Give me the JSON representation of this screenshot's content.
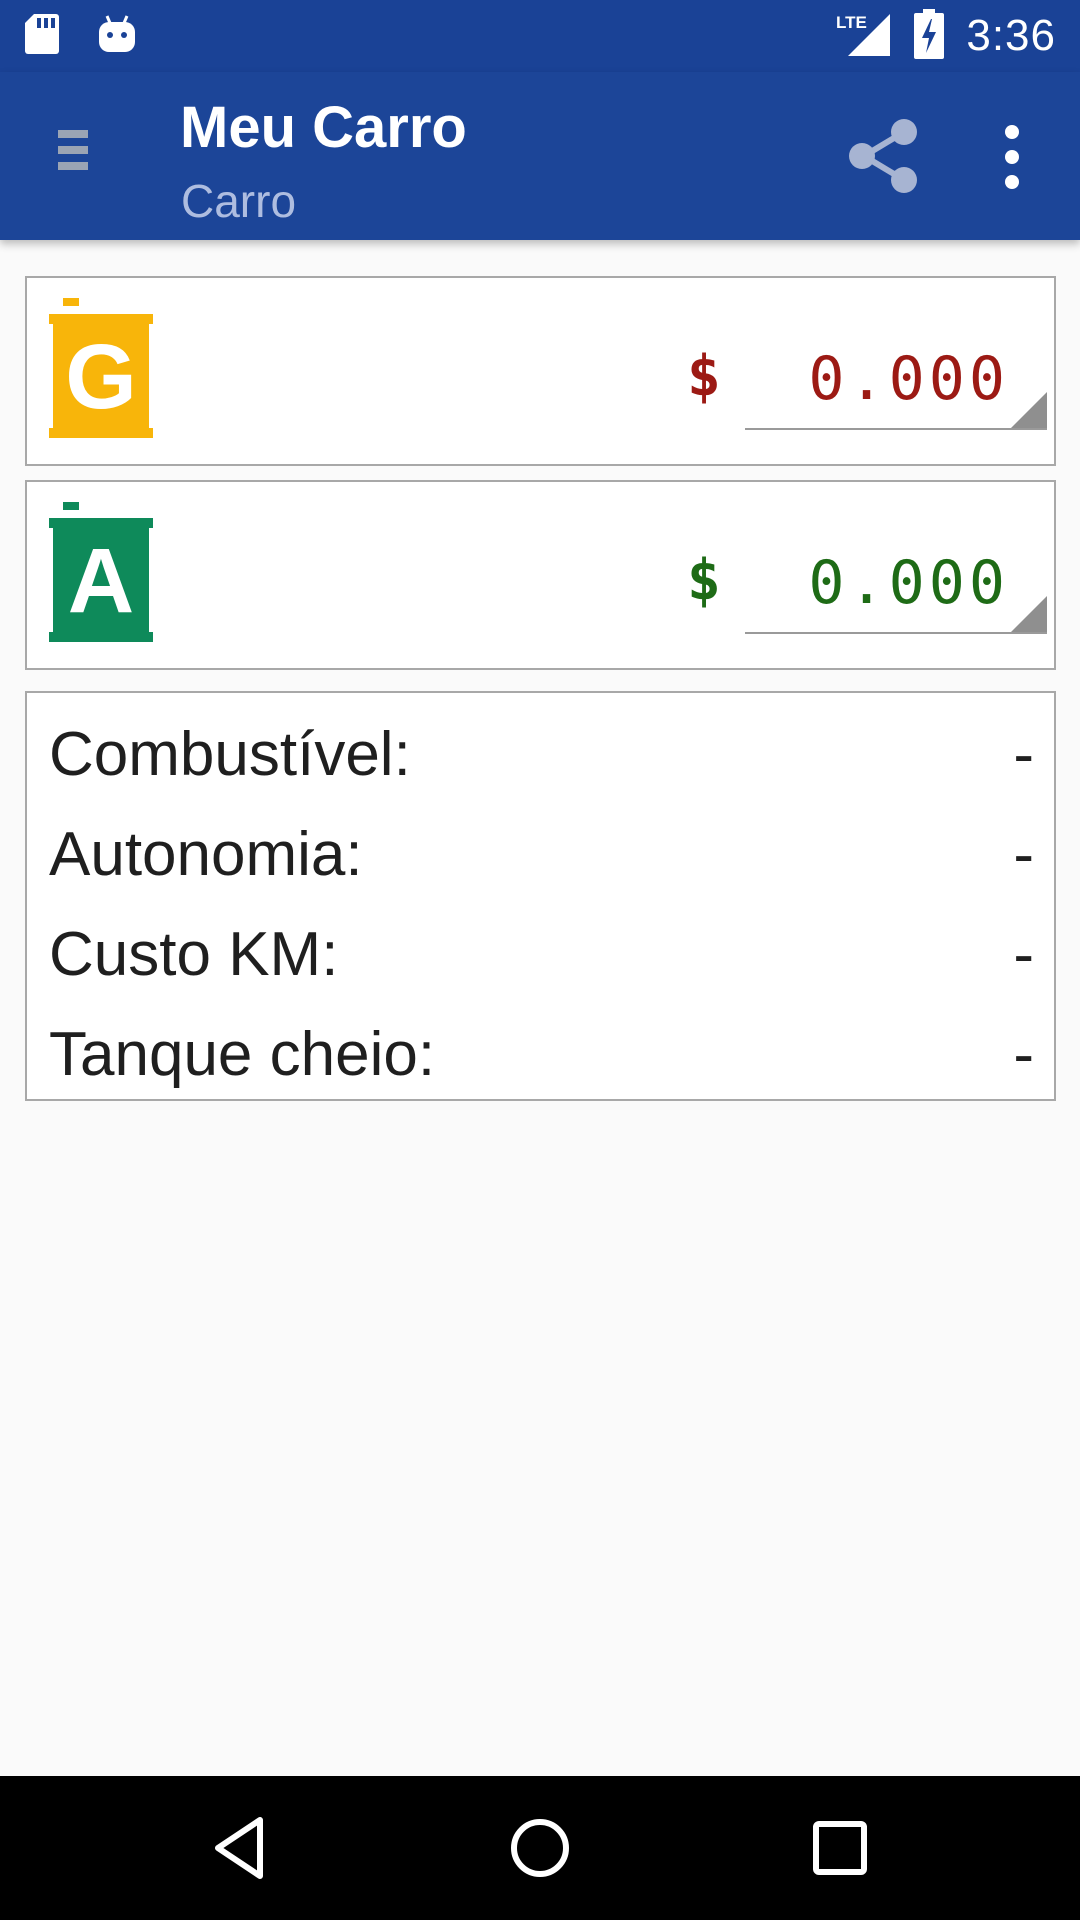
{
  "status_bar": {
    "time": "3:36",
    "network": "LTE",
    "left_icons": [
      "sd-card-icon",
      "android-icon"
    ]
  },
  "app_bar": {
    "title": "Meu Carro",
    "subtitle": "Carro",
    "actions": [
      "menu-icon",
      "share-icon",
      "more-vert-icon"
    ]
  },
  "fuels": [
    {
      "letter": "G",
      "currency": "$",
      "price": "0.000",
      "icon_color": "#f8b50a",
      "text_color": "#9c1a14"
    },
    {
      "letter": "A",
      "currency": "$",
      "price": "0.000",
      "icon_color": "#0e8a5a",
      "text_color": "#1e6b16"
    }
  ],
  "info": {
    "rows": [
      {
        "label": "Combustível:",
        "value": "-"
      },
      {
        "label": "Autonomia:",
        "value": "-"
      },
      {
        "label": "Custo KM:",
        "value": "-"
      },
      {
        "label": "Tanque cheio:",
        "value": "-"
      }
    ]
  },
  "nav_bar": {
    "buttons": [
      "back-icon",
      "home-icon",
      "recents-icon"
    ]
  },
  "colors": {
    "primary": "#1c4598",
    "status_bar": "#1a4296",
    "background": "#fafafa"
  }
}
